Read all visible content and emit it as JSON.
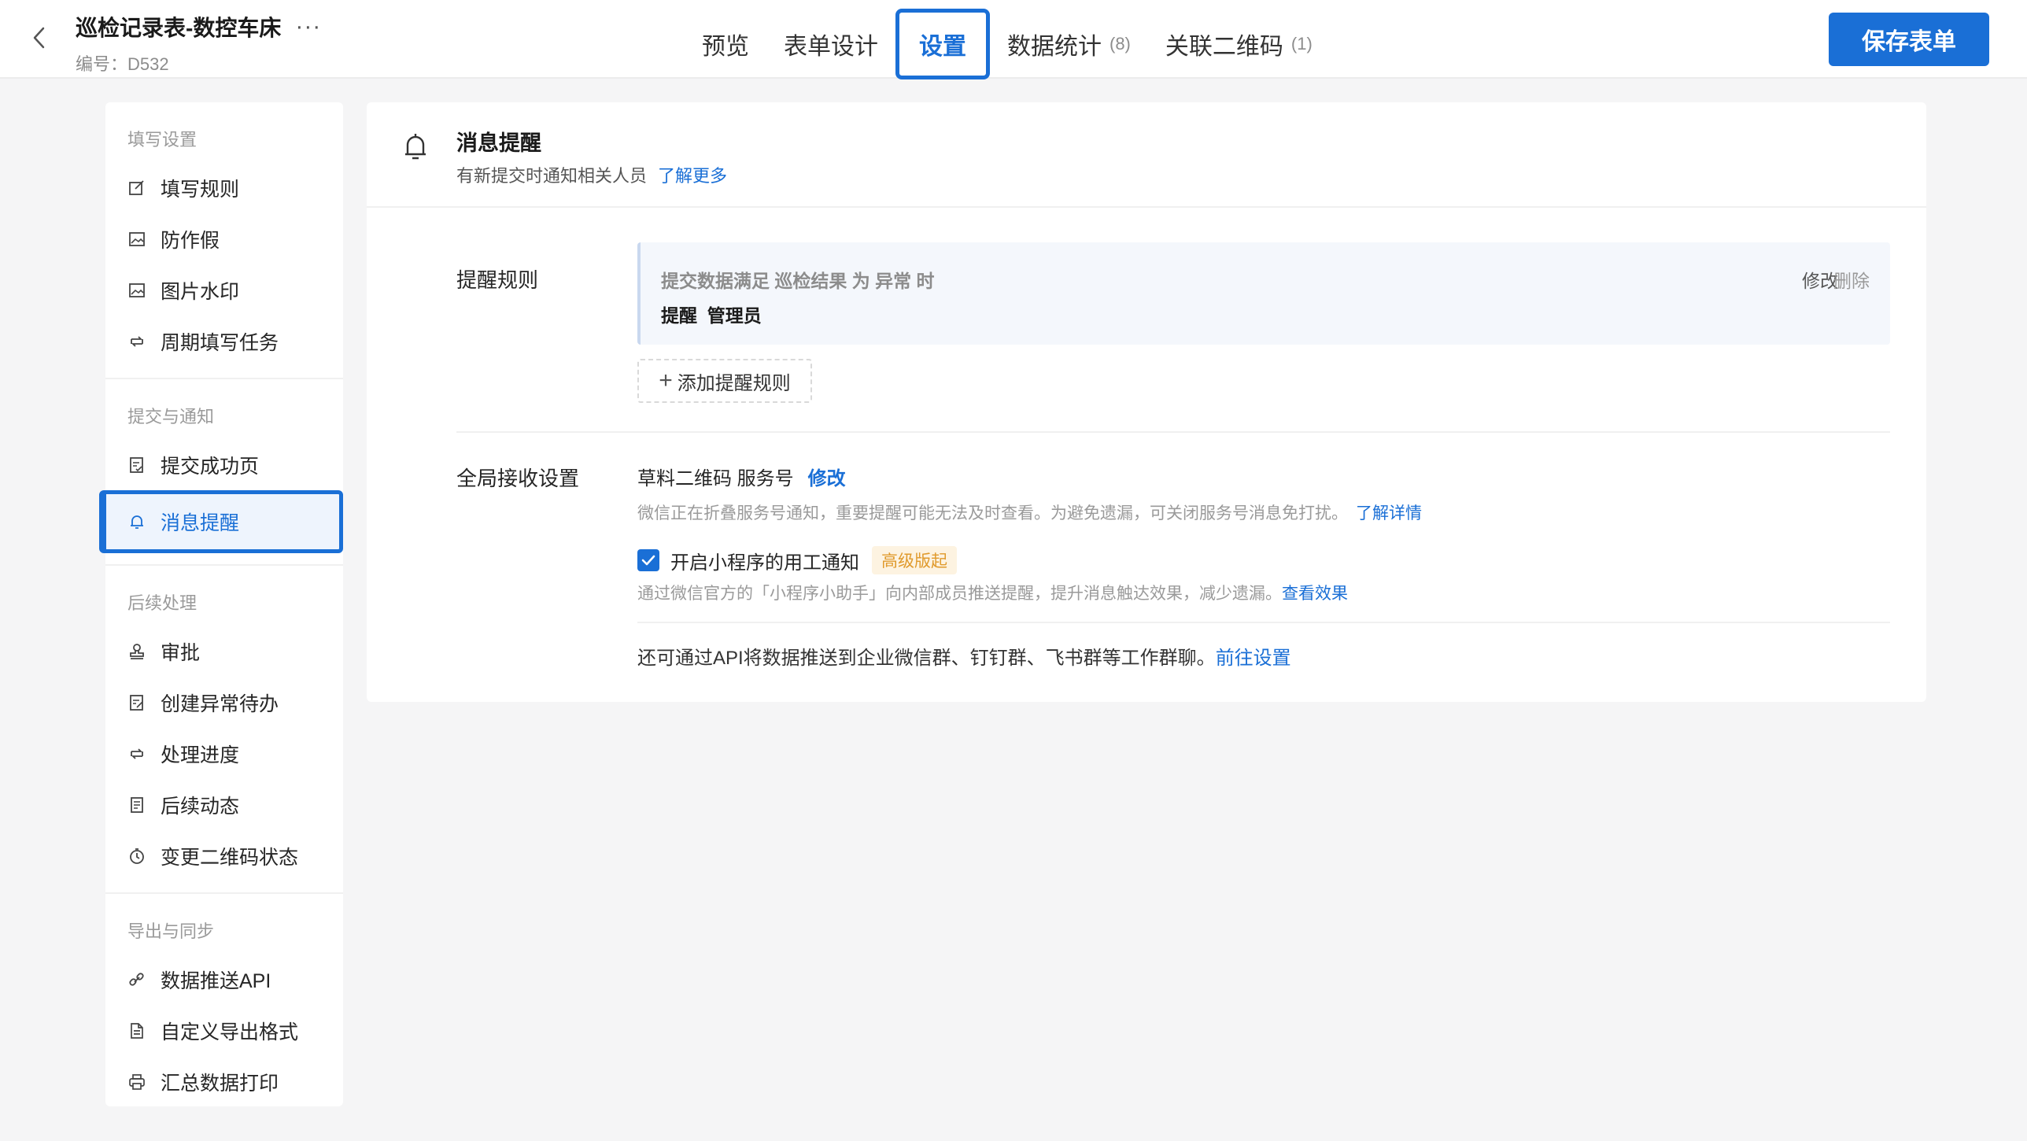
{
  "header": {
    "form_title": "巡检记录表-数控车床",
    "more": "···",
    "form_code": "编号：D532",
    "tabs": [
      {
        "label": "预览",
        "count": ""
      },
      {
        "label": "表单设计",
        "count": ""
      },
      {
        "label": "设置",
        "count": ""
      },
      {
        "label": "数据统计",
        "count": "(8)"
      },
      {
        "label": "关联二维码",
        "count": "(1)"
      }
    ],
    "active_tab": "设置",
    "save_label": "保存表单",
    "accent_color": "#1a6fd6"
  },
  "sidebar": {
    "groups": [
      {
        "title": "填写设置",
        "items": [
          {
            "label": "填写规则",
            "icon": "edit-icon"
          },
          {
            "label": "防作假",
            "icon": "image-icon"
          },
          {
            "label": "图片水印",
            "icon": "image-icon"
          },
          {
            "label": "周期填写任务",
            "icon": "cycle-icon"
          }
        ]
      },
      {
        "title": "提交与通知",
        "items": [
          {
            "label": "提交成功页",
            "icon": "doc-check-icon"
          },
          {
            "label": "消息提醒",
            "icon": "bell-icon",
            "active": true
          }
        ]
      },
      {
        "title": "后续处理",
        "items": [
          {
            "label": "审批",
            "icon": "stamp-icon"
          },
          {
            "label": "创建异常待办",
            "icon": "doc-edit-icon"
          },
          {
            "label": "处理进度",
            "icon": "cycle-icon"
          },
          {
            "label": "后续动态",
            "icon": "doc-list-icon"
          },
          {
            "label": "变更二维码状态",
            "icon": "clock-icon"
          }
        ]
      },
      {
        "title": "导出与同步",
        "items": [
          {
            "label": "数据推送API",
            "icon": "link-icon"
          },
          {
            "label": "自定义导出格式",
            "icon": "file-icon"
          },
          {
            "label": "汇总数据打印",
            "icon": "printer-icon"
          }
        ]
      }
    ]
  },
  "main": {
    "title": "消息提醒",
    "subtitle": "有新提交时通知相关人员",
    "learn_more": "了解更多",
    "rule_label": "提醒规则",
    "rule": {
      "condition": "提交数据满足 巡检结果 为 异常 时",
      "action": "提醒  管理员",
      "edit": "修改",
      "delete": "删除"
    },
    "add_rule": "添加提醒规则",
    "global_label": "全局接收设置",
    "service_account": "草料二维码 服务号",
    "service_edit": "修改",
    "service_hint": "微信正在折叠服务号通知，重要提醒可能无法及时查看。为避免遗漏，可关闭服务号消息免打扰。",
    "service_hint_link": "了解详情",
    "mini_program_label": "开启小程序的用工通知",
    "mini_program_checked": true,
    "mini_program_badge": "高级版起",
    "mini_program_hint": "通过微信官方的「小程序小助手」向内部成员推送提醒，提升消息触达效果，减少遗漏。",
    "mini_program_hint_link": "查看效果",
    "api_text": "还可通过API将数据推送到企业微信群、钉钉群、飞书群等工作群聊。",
    "api_link": "前往设置"
  }
}
